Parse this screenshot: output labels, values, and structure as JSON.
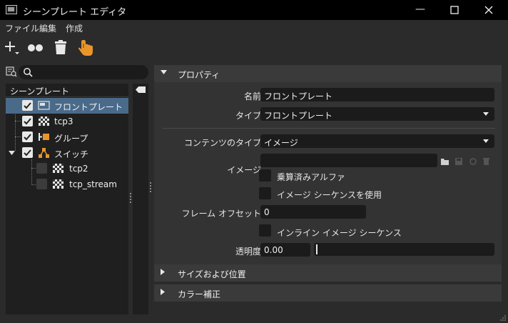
{
  "window": {
    "title": "シーンプレート エディタ",
    "minimize": "—",
    "maximize": "☐",
    "close": "✕"
  },
  "menu": {
    "file": "ファイル",
    "edit": "編集",
    "create": "作成"
  },
  "toolbar": {
    "icons": [
      "add-icon",
      "dots-icon",
      "trash-icon",
      "hand-pointer-icon"
    ],
    "accent": "#e8962b"
  },
  "search": {
    "placeholder": ""
  },
  "tree": {
    "header": "シーンプレート",
    "items": [
      {
        "label": "フロントプレート",
        "checked": true,
        "icon": "frontplate-icon",
        "selected": true
      },
      {
        "label": "tcp3",
        "checked": true,
        "icon": "checker-icon"
      },
      {
        "label": "グループ",
        "checked": true,
        "icon": "group-icon"
      },
      {
        "label": "スイッチ",
        "checked": true,
        "icon": "switch-icon",
        "expanded": true
      },
      {
        "label": "tcp2",
        "checked": false,
        "icon": "checker-icon"
      },
      {
        "label": "tcp_stream",
        "checked": false,
        "icon": "checker-icon"
      }
    ]
  },
  "properties": {
    "section_title": "プロパティ",
    "name_label": "名前",
    "name_value": "フロントプレート",
    "type_label": "タイプ",
    "type_value": "フロントプレート",
    "content_type_label": "コンテンツのタイプ",
    "content_type_value": "イメージ",
    "image_label": "イメージ",
    "image_value": "",
    "premult_label": "乗算済みアルファ",
    "sequence_label": "イメージ シーケンスを使用",
    "frame_offset_label": "フレーム オフセット",
    "frame_offset_value": "0",
    "inline_seq_label": "インライン イメージ シーケンス",
    "opacity_label": "透明度",
    "opacity_value": "0.00"
  },
  "sections": {
    "size_position": "サイズおよび位置",
    "color_correction": "カラー補正"
  },
  "colors": {
    "selection": "#4a6a8a",
    "orange": "#e8962b"
  }
}
